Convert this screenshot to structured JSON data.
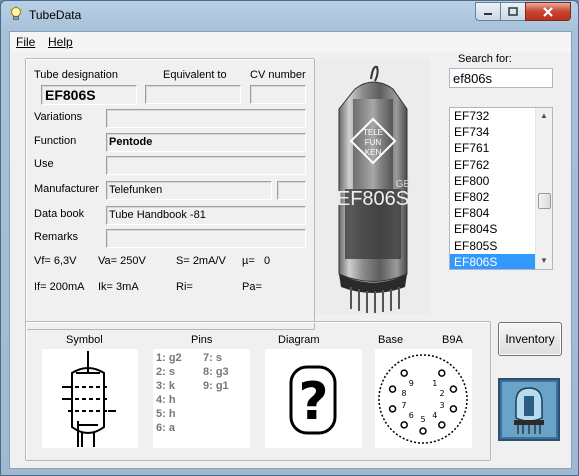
{
  "window": {
    "title": "TubeData"
  },
  "menu": {
    "file": "File",
    "help": "Help"
  },
  "labels": {
    "tube_designation": "Tube designation",
    "equivalent_to": "Equivalent to",
    "cv_number": "CV number",
    "variations": "Variations",
    "function": "Function",
    "use": "Use",
    "manufacturer": "Manufacturer",
    "data_book": "Data book",
    "remarks": "Remarks",
    "search_for": "Search for:",
    "symbol": "Symbol",
    "pins": "Pins",
    "diagram": "Diagram",
    "base": "Base",
    "base_type": "B9A"
  },
  "tube": {
    "designation": "EF806S",
    "equivalent": "",
    "cv": "",
    "variations": "",
    "function": "Pentode",
    "use": "",
    "manufacturer": "Telefunken",
    "manufacturer_extra": "",
    "data_book": "Tube Handbook -81",
    "remarks": ""
  },
  "specs": {
    "vf": "Vf= 6,3V",
    "va": "Va= 250V",
    "s": "S= 2mA/V",
    "mu": "µ=",
    "mu_val": "0",
    "if": "If= 200mA",
    "ik": "Ik= 3mA",
    "ri": "Ri=",
    "pa": "Pa="
  },
  "search": {
    "value": "ef806s"
  },
  "list": {
    "items": [
      "EF732",
      "EF734",
      "EF761",
      "EF762",
      "EF800",
      "EF802",
      "EF804",
      "EF804S",
      "EF805S",
      "EF806S"
    ],
    "selected_index": 9
  },
  "pins": {
    "left": [
      "1: g2",
      "2: s",
      "3: k",
      "4: h",
      "5: h",
      "6: a"
    ],
    "right": [
      "7: s",
      "8: g3",
      "9: g1"
    ]
  },
  "buttons": {
    "inventory": "Inventory"
  },
  "photo": {
    "brand_lines": [
      "TELE",
      "FUN",
      "KEN"
    ],
    "print": "EF806S",
    "side": "GE"
  },
  "diagram": {
    "glyph": "?"
  },
  "base_numbers": [
    "1",
    "2",
    "3",
    "4",
    "5",
    "6",
    "7",
    "8",
    "9"
  ]
}
